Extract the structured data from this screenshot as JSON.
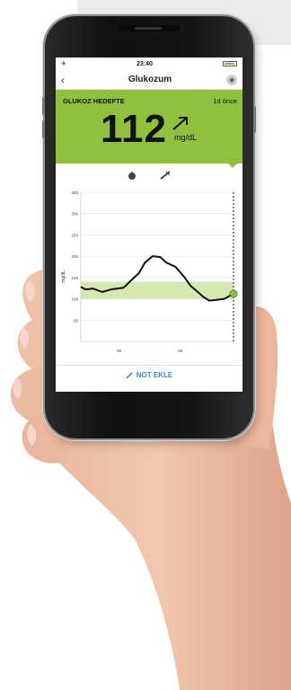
{
  "status": {
    "time": "23:40"
  },
  "nav": {
    "title": "Glukozum"
  },
  "reading": {
    "label": "GLUKOZ HEDEFTE",
    "time_ago": "1d önce",
    "value": "112",
    "unit": "mg/dL",
    "trend": "up-right"
  },
  "chart_data": {
    "type": "line",
    "ylabel": "mg/dL",
    "yticks": [
      50,
      100,
      150,
      200,
      250,
      300,
      350
    ],
    "ylim": [
      0,
      350
    ],
    "xticks": [
      "06",
      "09"
    ],
    "target_range": [
      100,
      140
    ],
    "series": [
      {
        "values": [
          [
            0,
            128
          ],
          [
            0.03,
            122
          ],
          [
            0.08,
            124
          ],
          [
            0.14,
            116
          ],
          [
            0.2,
            122
          ],
          [
            0.28,
            126
          ],
          [
            0.32,
            140
          ],
          [
            0.38,
            160
          ],
          [
            0.42,
            185
          ],
          [
            0.47,
            200
          ],
          [
            0.52,
            198
          ],
          [
            0.56,
            185
          ],
          [
            0.62,
            175
          ],
          [
            0.68,
            150
          ],
          [
            0.72,
            130
          ],
          [
            0.77,
            115
          ],
          [
            0.8,
            105
          ],
          [
            0.84,
            96
          ],
          [
            0.88,
            97
          ],
          [
            0.94,
            100
          ],
          [
            1.0,
            112
          ]
        ]
      }
    ],
    "colors": {
      "line": "#111111",
      "band": "#c9e49c",
      "current_point": "#8fc13f"
    },
    "grid": true
  },
  "note": {
    "label": "NOT EKLE"
  },
  "icons": {
    "meal": "apple-icon",
    "insulin": "syringe-icon",
    "note": "pencil-icon"
  }
}
